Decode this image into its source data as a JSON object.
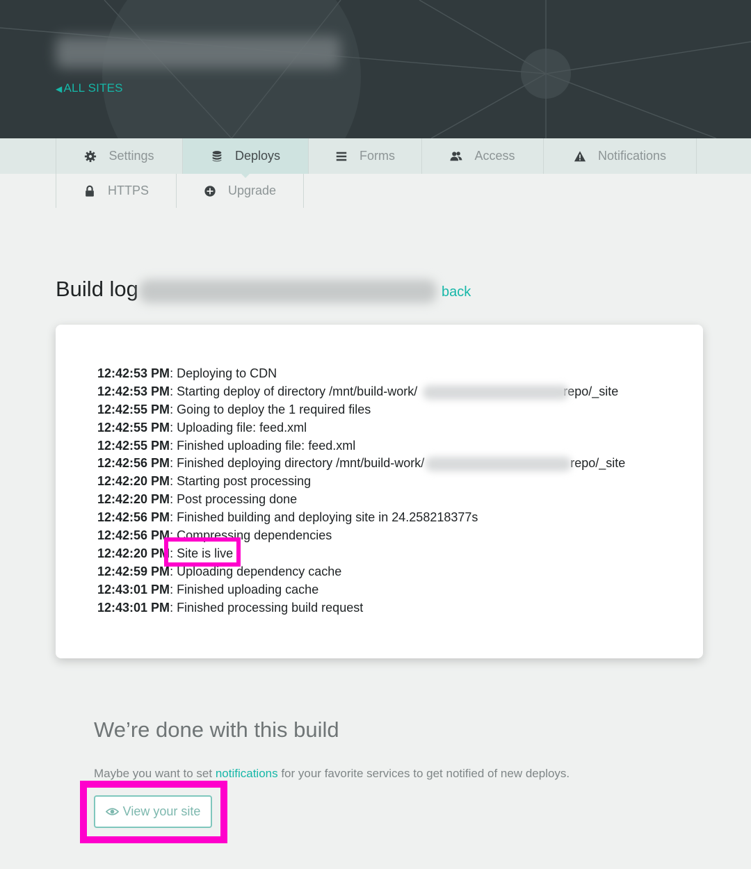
{
  "header": {
    "all_sites_label": "ALL SITES"
  },
  "tabs": [
    {
      "label": "Settings",
      "icon": "gear-icon"
    },
    {
      "label": "Deploys",
      "icon": "database-icon",
      "active": true
    },
    {
      "label": "Forms",
      "icon": "list-icon"
    },
    {
      "label": "Access",
      "icon": "users-icon"
    },
    {
      "label": "Notifications",
      "icon": "warning-icon"
    },
    {
      "label": "HTTPS",
      "icon": "lock-icon"
    },
    {
      "label": "Upgrade",
      "icon": "plus-circle-icon"
    }
  ],
  "build_log": {
    "title": "Build log",
    "back_label": "back",
    "lines": [
      {
        "time": "12:42:53 PM",
        "message": ": Deploying to CDN"
      },
      {
        "time": "12:42:53 PM",
        "message": ": Starting deploy of directory /mnt/build-work/",
        "message_end": "repo/_site"
      },
      {
        "time": "12:42:55 PM",
        "message": ": Going to deploy the 1 required files"
      },
      {
        "time": "12:42:55 PM",
        "message": ": Uploading file: feed.xml"
      },
      {
        "time": "12:42:55 PM",
        "message": ": Finished uploading file: feed.xml"
      },
      {
        "time": "12:42:56 PM",
        "message": ": Finished deploying directory /mnt/build-work/",
        "message_end": "repo/_site"
      },
      {
        "time": "12:42:20 PM",
        "message": ": Starting post processing"
      },
      {
        "time": "12:42:20 PM",
        "message": ": Post processing done"
      },
      {
        "time": "12:42:56 PM",
        "message": ": Finished building and deploying site in 24.258218377s"
      },
      {
        "time": "12:42:56 PM",
        "message": ": Compressing dependencies"
      },
      {
        "time": "12:42:20 PM",
        "message": ": Site is live"
      },
      {
        "time": "12:42:59 PM",
        "message": ": Uploading dependency cache"
      },
      {
        "time": "12:43:01 PM",
        "message": ": Finished uploading cache"
      },
      {
        "time": "12:43:01 PM",
        "message": ": Finished processing build request"
      }
    ]
  },
  "done": {
    "title": "We’re done with this build",
    "text_before": "Maybe you want to set ",
    "link": "notifications",
    "text_after": " for your favorite services to get notified of new deploys.",
    "view_button_label": "View your site",
    "view_button_icon": "eye-icon"
  },
  "colors": {
    "accent": "#16b7a8",
    "header_bg": "#313a3d",
    "highlight": "#ff00cc"
  }
}
